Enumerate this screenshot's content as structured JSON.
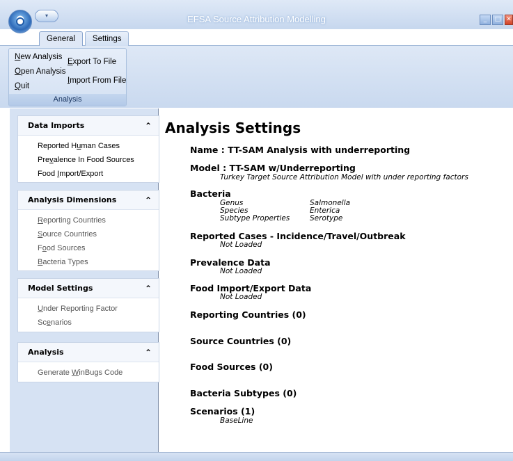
{
  "window": {
    "title": "EFSA Source Attribution Modelling",
    "qat_glyph": "▾"
  },
  "tabs": [
    {
      "label": "General",
      "active": true
    },
    {
      "label": "Settings",
      "active": false
    }
  ],
  "ribbon": {
    "group_label": "Analysis",
    "buttons": {
      "new_analysis": {
        "u": "N",
        "rest": "ew Analysis"
      },
      "open_analysis": {
        "u": "O",
        "rest": "pen Analysis"
      },
      "quit": {
        "u": "Q",
        "rest": "uit"
      },
      "export_to_file": {
        "u": "E",
        "rest": "xport To File"
      },
      "import_from_file": {
        "u": "I",
        "rest": "mport From File"
      }
    }
  },
  "sidebar": {
    "data_imports": {
      "title": "Data Imports",
      "items": [
        {
          "pre": "Reported H",
          "u": "u",
          "post": "man Cases"
        },
        {
          "pre": "Pre",
          "u": "v",
          "post": "alence In Food Sources"
        },
        {
          "pre": "Food ",
          "u": "I",
          "post": "mport/Export"
        }
      ]
    },
    "analysis_dimensions": {
      "title": "Analysis Dimensions",
      "items": [
        {
          "pre": "",
          "u": "R",
          "post": "eporting Countries"
        },
        {
          "pre": "",
          "u": "S",
          "post": "ource Countries"
        },
        {
          "pre": "F",
          "u": "o",
          "post": "od Sources"
        },
        {
          "pre": "",
          "u": "B",
          "post": "acteria Types"
        }
      ]
    },
    "model_settings": {
      "title": "Model Settings",
      "items": [
        {
          "pre": "",
          "u": "U",
          "post": "nder Reporting Factor"
        },
        {
          "pre": "Sc",
          "u": "e",
          "post": "narios"
        }
      ]
    },
    "analysis": {
      "title": "Analysis",
      "items": [
        {
          "pre": "Generate ",
          "u": "W",
          "post": "inBugs Code"
        }
      ]
    },
    "chevron": "⌃"
  },
  "main": {
    "heading": "Analysis Settings",
    "name": "Name : TT-SAM Analysis with underreporting",
    "model": "Model : TT-SAM w/Underreporting",
    "model_desc": "Turkey Target Source Attribution Model with under reporting factors",
    "bacteria": "Bacteria",
    "bacteria_fields": [
      {
        "key": "Genus",
        "value": "Salmonella"
      },
      {
        "key": "Species",
        "value": "Enterica"
      },
      {
        "key": "Subtype Properties",
        "value": "Serotype"
      }
    ],
    "reported_cases": "Reported Cases - Incidence/Travel/Outbreak",
    "reported_cases_status": "Not Loaded",
    "prevalence": "Prevalence Data",
    "prevalence_status": "Not Loaded",
    "food_import_export": "Food Import/Export Data",
    "food_import_export_status": "Not Loaded",
    "reporting_countries": "Reporting Countries (0)",
    "source_countries": "Source Countries (0)",
    "food_sources": "Food Sources (0)",
    "bacteria_subtypes": "Bacteria Subtypes (0)",
    "scenarios": "Scenarios (1)",
    "scenario_1": "BaseLine"
  }
}
